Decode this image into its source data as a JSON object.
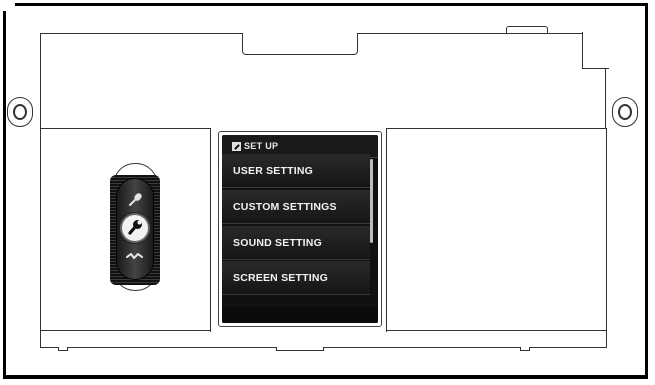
{
  "screen": {
    "header": {
      "icon": "setup-pencil-icon",
      "title": "SET UP"
    },
    "menu_items": [
      {
        "label": "USER SETTING"
      },
      {
        "label": "CUSTOM SETTINGS"
      },
      {
        "label": "SOUND SETTING"
      },
      {
        "label": "SCREEN SETTING"
      }
    ]
  },
  "dial": {
    "icons": [
      "microphone-icon",
      "wrench-icon",
      "wave-icon"
    ]
  },
  "colors": {
    "lcd_background": "#111111",
    "menu_text": "#f2f2f2",
    "body_outline": "#333333"
  }
}
